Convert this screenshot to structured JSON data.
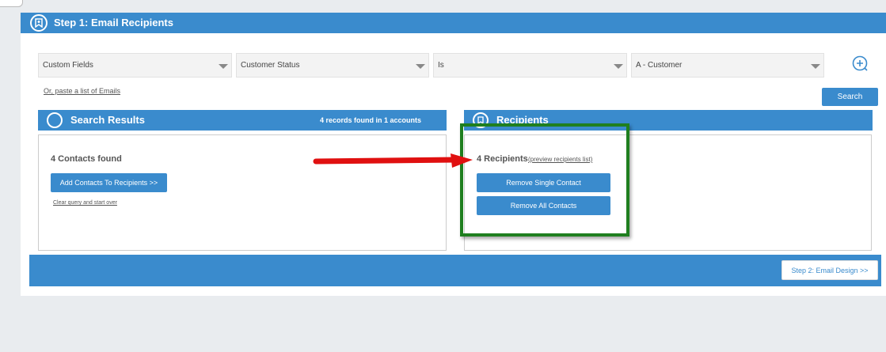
{
  "step": {
    "title": "Step 1: Email Recipients"
  },
  "filters": {
    "field": "Custom Fields",
    "subfield": "Customer Status",
    "operator": "Is",
    "value": "A - Customer"
  },
  "paste_link": "Or, paste a list of Emails",
  "search_button": "Search",
  "search_results": {
    "title": "Search Results",
    "count": "4 records found in 1 accounts",
    "contacts_found": "4 Contacts found",
    "add_button": "Add Contacts To Recipients >>",
    "clear_link": "Clear query and start over"
  },
  "recipients": {
    "title": "Recipients",
    "count": "4 Recipients",
    "preview_link": "(preview recipients list)",
    "remove_single": "Remove Single Contact",
    "remove_all": "Remove All Contacts"
  },
  "footer": {
    "next_button": "Step 2: Email Design >>"
  },
  "colors": {
    "primary": "#3a8bcd",
    "highlight_border": "#1f7f1f",
    "arrow": "#e01010"
  }
}
